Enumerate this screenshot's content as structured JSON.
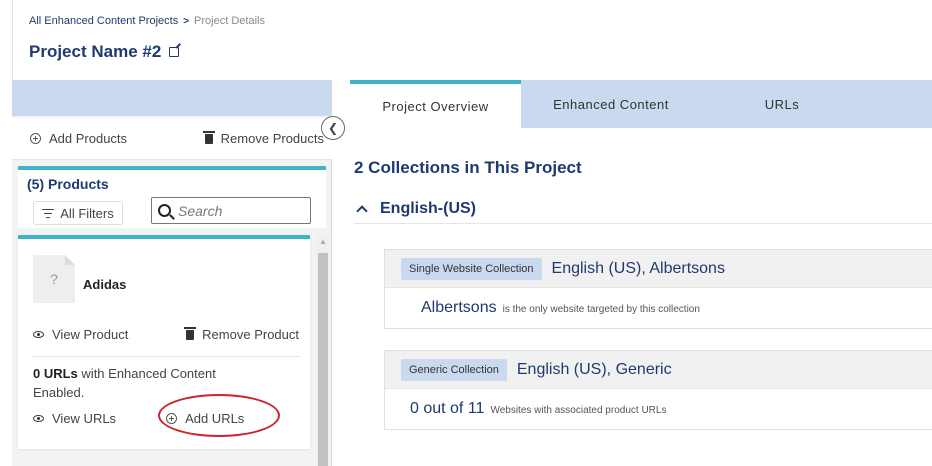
{
  "breadcrumb": {
    "link": "All Enhanced Content Projects",
    "separator": ">",
    "current": "Project Details"
  },
  "project": {
    "title": "Project Name #2"
  },
  "left_panel": {
    "add_products": "Add Products",
    "remove_products": "Remove Products",
    "products_title": "(5) Products",
    "filter_label": "All Filters",
    "search_placeholder": "Search"
  },
  "product": {
    "thumb_placeholder": "?",
    "name": "Adidas",
    "view_product": "View Product",
    "remove_product": "Remove Product",
    "url_count": "0 URLs",
    "url_text": "with Enhanced Content Enabled.",
    "view_urls": "View URLs",
    "add_urls": "Add URLs"
  },
  "tabs": [
    {
      "label": "Project Overview",
      "active": true
    },
    {
      "label": "Enhanced Content",
      "active": false
    },
    {
      "label": "URLs",
      "active": false
    }
  ],
  "overview": {
    "section_title": "2 Collections in This Project",
    "group_label": "English-(US)",
    "collections": [
      {
        "badge": "Single Website Collection",
        "name": "English (US), Albertsons",
        "highlight": "Albertsons",
        "note": "is the only website targeted by this collection"
      },
      {
        "badge": "Generic Collection",
        "name": "English (US), Generic",
        "highlight": "0 out of 11",
        "note": "Websites with associated product URLs"
      }
    ]
  },
  "colors": {
    "primary_text": "#1f3a6e",
    "accent": "#3fb3c8",
    "tab_bar": "#c9d9ef",
    "highlight_annotation": "#c8262c"
  }
}
